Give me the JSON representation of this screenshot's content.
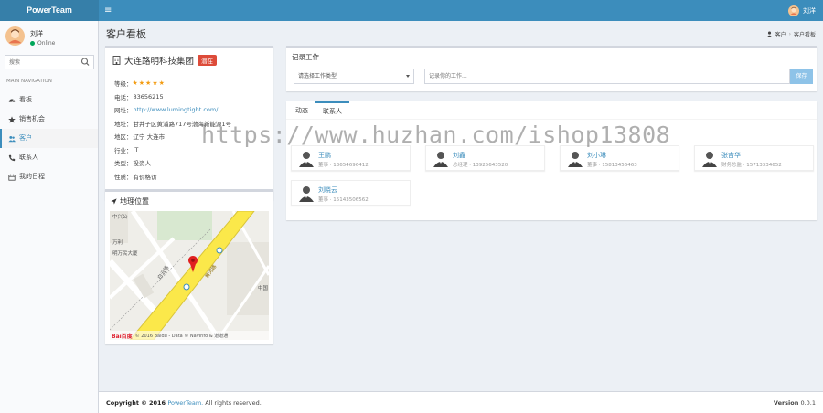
{
  "app": {
    "brand": "PowerTeam",
    "menu_toggle": "≡"
  },
  "user": {
    "name": "刘洋",
    "status": "Online"
  },
  "sidebar": {
    "search_placeholder": "搜索",
    "nav_header": "MAIN NAVIGATION",
    "items": [
      {
        "label": "看板",
        "icon": "dashboard-icon"
      },
      {
        "label": "销售机会",
        "icon": "star-icon"
      },
      {
        "label": "客户",
        "icon": "users-icon"
      },
      {
        "label": "联系人",
        "icon": "phone-icon"
      },
      {
        "label": "我的日程",
        "icon": "calendar-icon"
      }
    ]
  },
  "page": {
    "title": "客户看板",
    "breadcrumb": [
      "客户",
      "客户看板"
    ]
  },
  "company": {
    "name": "大连路明科技集团",
    "badge": "潜在",
    "rating_label": "等级：",
    "rating_stars": "★★★★★",
    "fields": [
      {
        "label": "电话：",
        "value": "83656215"
      },
      {
        "label": "网址：",
        "value": "http://www.lumingtight.com/",
        "link": true
      },
      {
        "label": "地址：",
        "value": "甘井子区黄浦路717号渤海新能源1号"
      },
      {
        "label": "地区：",
        "value": "辽宁 大连市"
      },
      {
        "label": "行业：",
        "value": "IT"
      },
      {
        "label": "类型：",
        "value": "投资人"
      },
      {
        "label": "性质：",
        "value": "有价格访"
      }
    ]
  },
  "map": {
    "title": "地理位置",
    "labels": [
      "中兴公",
      "万利",
      "明万民大厦",
      "白云路",
      "中国"
    ],
    "road_name": "黄河路",
    "attribution_logo": "Bai百度",
    "attribution_text": "© 2016 Baidu - Data © NavInfo & 道道通"
  },
  "record": {
    "title": "记录工作",
    "select_value": "请选择工作类型",
    "input_placeholder": "记录你的工作...",
    "button": "保存"
  },
  "tabs": [
    {
      "label": "动态"
    },
    {
      "label": "联系人"
    }
  ],
  "contacts": [
    {
      "name": "王鹏",
      "info": "董事 · 13654696412"
    },
    {
      "name": "刘鑫",
      "info": "总经理 · 13925643520"
    },
    {
      "name": "刘小琳",
      "info": "董事 · 15813456463"
    },
    {
      "name": "张吉华",
      "info": "财务总监 · 15713334652"
    },
    {
      "name": "刘晓云",
      "info": "董事 · 15143506562"
    }
  ],
  "footer": {
    "copy_prefix": "Copyright © 2016 ",
    "copy_brand": "PowerTeam.",
    "copy_suffix": " All rights reserved.",
    "version_label": "Version",
    "version_value": "0.0.1"
  },
  "watermark": "https://www.huzhan.com/ishop13808",
  "colors": {
    "primary": "#3c8dbc",
    "brand_dark": "#367fa9",
    "badge": "#dd4b39",
    "star": "#f39c12",
    "online": "#00a65a"
  }
}
